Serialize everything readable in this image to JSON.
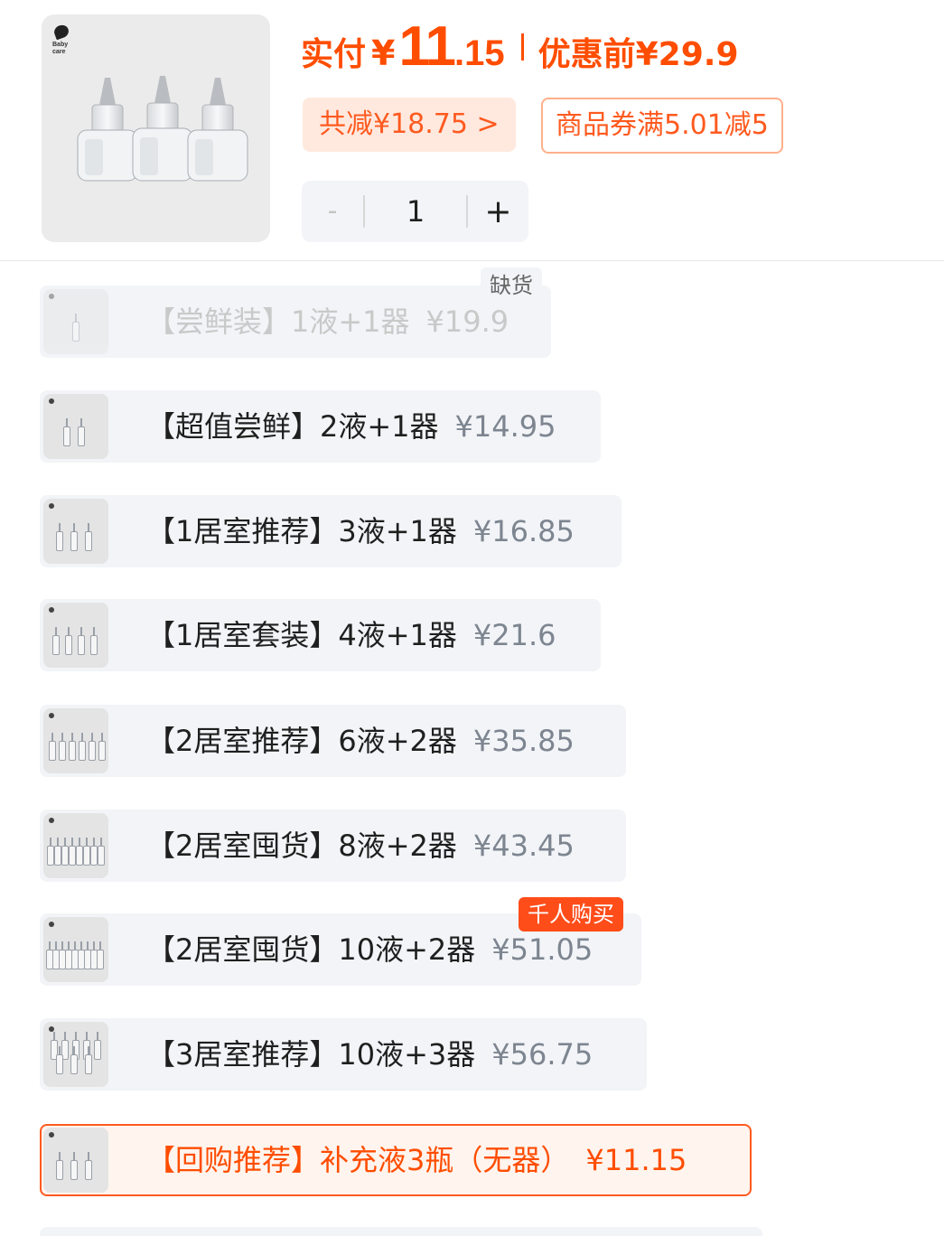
{
  "product": {
    "brand_logo_text": "Baby care",
    "paid_label": "实付",
    "currency": "¥",
    "paid_int": "11",
    "paid_dec": ".15",
    "before_label": "优惠前¥29.9",
    "reduce_badge": "共减¥18.75 >",
    "coupon_badge": "商品券满5.01减5"
  },
  "stepper": {
    "minus": "-",
    "value": "1",
    "plus": "+"
  },
  "tags": {
    "out_of_stock": "缺货",
    "hot": "千人购买"
  },
  "variants": [
    {
      "name": "【尝鲜装】1液+1器",
      "price": "¥19.9",
      "state": "disabled"
    },
    {
      "name": "【超值尝鲜】2液+1器",
      "price": "¥14.95",
      "state": "normal"
    },
    {
      "name": "【1居室推荐】3液+1器",
      "price": "¥16.85",
      "state": "normal"
    },
    {
      "name": "【1居室套装】4液+1器",
      "price": "¥21.6",
      "state": "normal"
    },
    {
      "name": "【2居室推荐】6液+2器",
      "price": "¥35.85",
      "state": "normal"
    },
    {
      "name": "【2居室囤货】8液+2器",
      "price": "¥43.45",
      "state": "normal"
    },
    {
      "name": "【2居室囤货】10液+2器",
      "price": "¥51.05",
      "state": "normal"
    },
    {
      "name": "【3居室推荐】10液+3器",
      "price": "¥56.75",
      "state": "normal"
    },
    {
      "name": "【回购推荐】补充液3瓶（无器）",
      "price": "¥11.15",
      "state": "selected"
    }
  ],
  "colors": {
    "accent": "#ff4d00",
    "option_bg": "#f2f4f7",
    "selected_bg": "#fff4ee"
  }
}
